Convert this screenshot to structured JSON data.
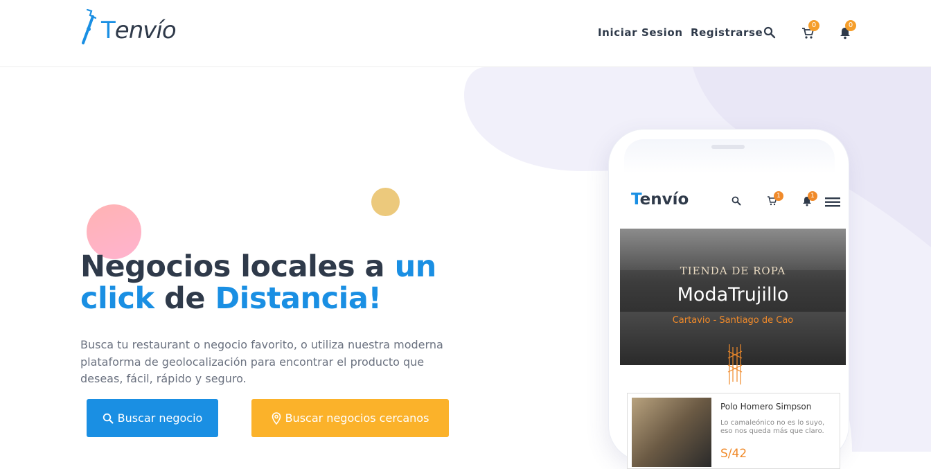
{
  "brand": {
    "first_letter": "T",
    "rest": "envío"
  },
  "nav": {
    "login": "Iniciar Sesion",
    "register": "Registrarse",
    "cart_count": "0",
    "notif_count": "0"
  },
  "hero": {
    "title_part1": "Negocios locales a ",
    "title_hl1": "un click",
    "title_part2": " de ",
    "title_hl2": "Distancia!",
    "description": "Busca tu restaurant o negocio favorito, o utiliza nuestra moderna plataforma de geolocalización para encontrar el producto que deseas, fácil, rápido y seguro.",
    "btn_search": "Buscar negocio",
    "btn_nearby": "Buscar negocios cercanos"
  },
  "phone": {
    "brand_first": "T",
    "brand_rest": "envío",
    "cart_count": "1",
    "notif_count": "1",
    "banner_subtitle": "TIENDA DE ROPA",
    "banner_title": "ModaTrujillo",
    "banner_location": "Cartavio - Santiago de Cao",
    "product_title": "Polo Homero Simpson",
    "product_desc": "Lo camaleónico no es lo suyo, eso nos queda más que claro.",
    "product_price": "S/42"
  },
  "colors": {
    "accent": "#1a8fe3",
    "orange": "#fbb22a",
    "dark": "#2f3a4a",
    "badge": "#f59e2b"
  }
}
